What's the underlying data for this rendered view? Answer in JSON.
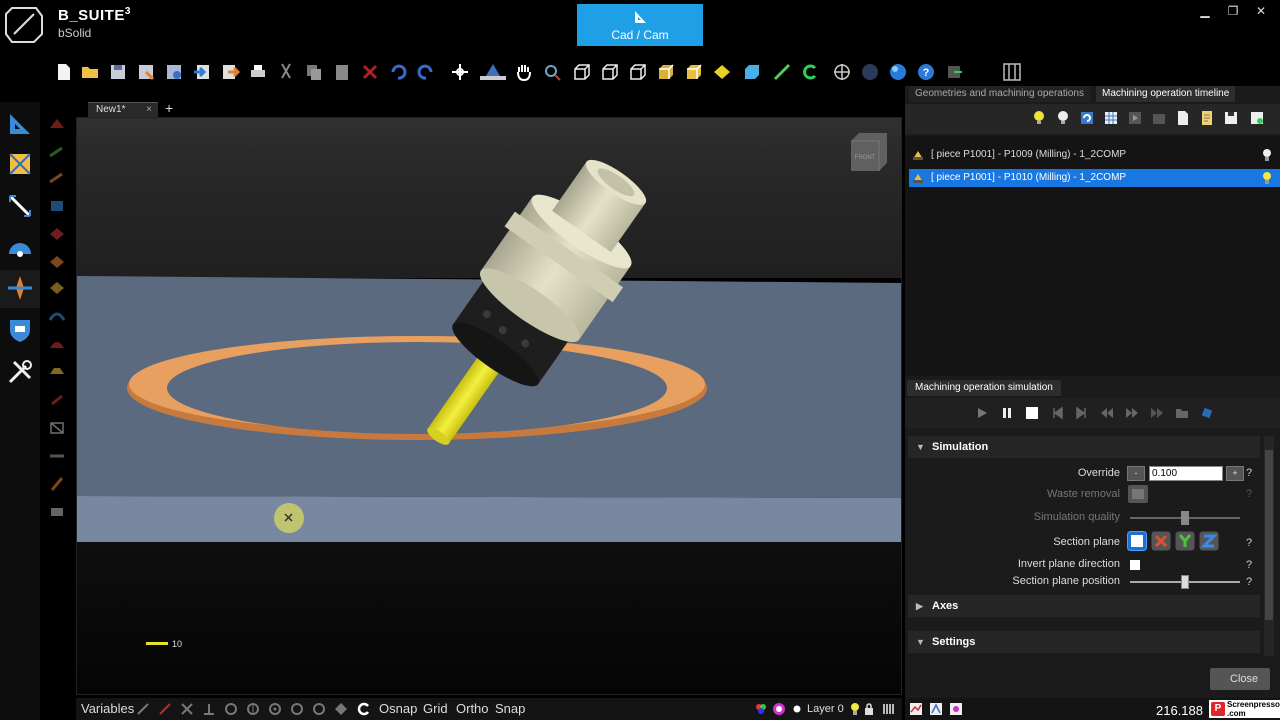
{
  "app": {
    "title": "B_SUITE",
    "title_sup": "3",
    "subtitle": "bSolid",
    "mode_button": "Cad / Cam"
  },
  "document": {
    "tab_label": "New1*",
    "close_glyph": "×",
    "add_glyph": "+"
  },
  "viewport": {
    "view_cube_label": "FRONT",
    "scale_label": "10"
  },
  "right_panel": {
    "tabs": [
      "Geometries and machining operations",
      "Machining operation timeline"
    ],
    "operations": [
      {
        "label": "[ piece P1001] - P1009 (Milling) - 1_2COMP",
        "selected": false
      },
      {
        "label": "[ piece P1001] - P1010 (Milling) - 1_2COMP",
        "selected": true
      }
    ],
    "simulation_tab": "Machining operation simulation",
    "simulation": {
      "header": "Simulation",
      "override_label": "Override",
      "override_value": "0.100",
      "waste_removal_label": "Waste removal",
      "simulation_quality_label": "Simulation quality",
      "simulation_quality": 0.5,
      "section_plane_label": "Section plane",
      "section_plane_buttons": [
        "none",
        "X",
        "Y",
        "Z"
      ],
      "invert_plane_label": "Invert plane direction",
      "section_position_label": "Section plane position",
      "section_position": 0.5,
      "help": "?",
      "minus": "-",
      "plus": "+"
    },
    "axes_header": "Axes",
    "settings_header": "Settings",
    "close_label": "Close"
  },
  "statusbar": {
    "variables": "Variables",
    "osnap": "Osnap",
    "grid": "Grid",
    "ortho": "Ortho",
    "snap": "Snap",
    "layer": "Layer 0",
    "coords": "216.188",
    "watermark_top": "Screenpresso",
    "watermark_bottom": ".com"
  },
  "colors": {
    "accent": "#1e9fe6",
    "selection": "#1877e0",
    "ring": "#d9884a",
    "tool_shaft": "#e8e22a",
    "holder": "#d8d6b8",
    "collet": "#1a1a1a",
    "table_plane": "#5c6a80"
  }
}
